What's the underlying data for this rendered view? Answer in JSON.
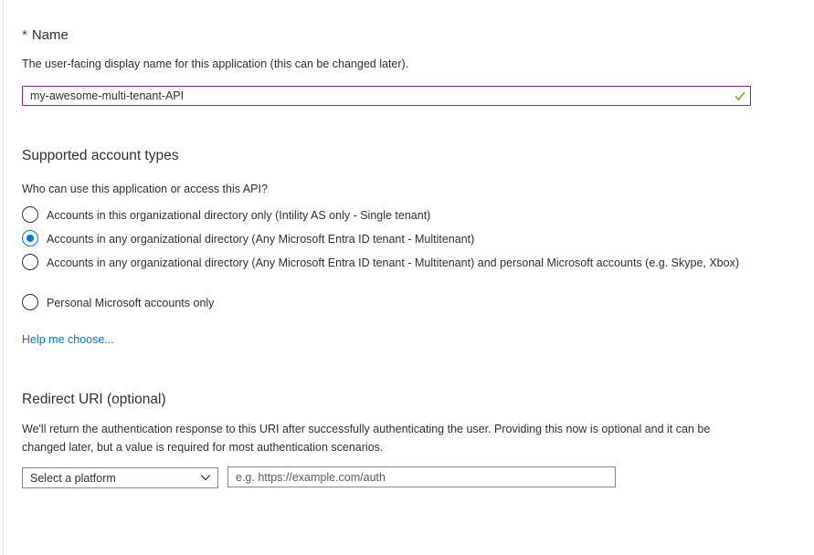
{
  "name_section": {
    "required_marker": "*",
    "heading": "Name",
    "description": "The user-facing display name for this application (this can be changed later).",
    "input_value": "my-awesome-multi-tenant-API",
    "valid": true
  },
  "account_types": {
    "heading": "Supported account types",
    "question": "Who can use this application or access this API?",
    "options": [
      {
        "label": "Accounts in this organizational directory only (Intility AS only - Single tenant)",
        "selected": false
      },
      {
        "label": "Accounts in any organizational directory (Any Microsoft Entra ID tenant - Multitenant)",
        "selected": true
      },
      {
        "label": "Accounts in any organizational directory (Any Microsoft Entra ID tenant - Multitenant) and personal Microsoft accounts (e.g. Skype, Xbox)",
        "selected": false
      },
      {
        "label": "Personal Microsoft accounts only",
        "selected": false
      }
    ],
    "help_link": "Help me choose..."
  },
  "redirect": {
    "heading": "Redirect URI (optional)",
    "description": "We'll return the authentication response to this URI after successfully authenticating the user. Providing this now is optional and it can be changed later, but a value is required for most authentication scenarios.",
    "platform_select": "Select a platform",
    "uri_placeholder": "e.g. https://example.com/auth",
    "uri_value": ""
  },
  "icons": {
    "valid_check": "checkmark-icon",
    "dropdown": "chevron-down-icon"
  },
  "colors": {
    "accent": "#0078d4",
    "focus_border": "#7a2f8f",
    "success": "#57a300",
    "required": "#a4262c",
    "text": "#323130"
  }
}
